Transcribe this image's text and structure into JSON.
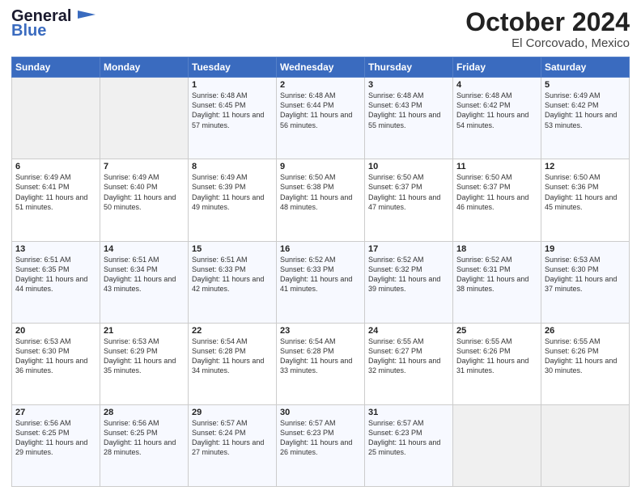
{
  "header": {
    "logo_line1": "General",
    "logo_line2": "Blue",
    "title": "October 2024",
    "subtitle": "El Corcovado, Mexico"
  },
  "calendar": {
    "headers": [
      "Sunday",
      "Monday",
      "Tuesday",
      "Wednesday",
      "Thursday",
      "Friday",
      "Saturday"
    ],
    "weeks": [
      [
        {
          "day": "",
          "detail": ""
        },
        {
          "day": "",
          "detail": ""
        },
        {
          "day": "1",
          "detail": "Sunrise: 6:48 AM\nSunset: 6:45 PM\nDaylight: 11 hours and 57 minutes."
        },
        {
          "day": "2",
          "detail": "Sunrise: 6:48 AM\nSunset: 6:44 PM\nDaylight: 11 hours and 56 minutes."
        },
        {
          "day": "3",
          "detail": "Sunrise: 6:48 AM\nSunset: 6:43 PM\nDaylight: 11 hours and 55 minutes."
        },
        {
          "day": "4",
          "detail": "Sunrise: 6:48 AM\nSunset: 6:42 PM\nDaylight: 11 hours and 54 minutes."
        },
        {
          "day": "5",
          "detail": "Sunrise: 6:49 AM\nSunset: 6:42 PM\nDaylight: 11 hours and 53 minutes."
        }
      ],
      [
        {
          "day": "6",
          "detail": "Sunrise: 6:49 AM\nSunset: 6:41 PM\nDaylight: 11 hours and 51 minutes."
        },
        {
          "day": "7",
          "detail": "Sunrise: 6:49 AM\nSunset: 6:40 PM\nDaylight: 11 hours and 50 minutes."
        },
        {
          "day": "8",
          "detail": "Sunrise: 6:49 AM\nSunset: 6:39 PM\nDaylight: 11 hours and 49 minutes."
        },
        {
          "day": "9",
          "detail": "Sunrise: 6:50 AM\nSunset: 6:38 PM\nDaylight: 11 hours and 48 minutes."
        },
        {
          "day": "10",
          "detail": "Sunrise: 6:50 AM\nSunset: 6:37 PM\nDaylight: 11 hours and 47 minutes."
        },
        {
          "day": "11",
          "detail": "Sunrise: 6:50 AM\nSunset: 6:37 PM\nDaylight: 11 hours and 46 minutes."
        },
        {
          "day": "12",
          "detail": "Sunrise: 6:50 AM\nSunset: 6:36 PM\nDaylight: 11 hours and 45 minutes."
        }
      ],
      [
        {
          "day": "13",
          "detail": "Sunrise: 6:51 AM\nSunset: 6:35 PM\nDaylight: 11 hours and 44 minutes."
        },
        {
          "day": "14",
          "detail": "Sunrise: 6:51 AM\nSunset: 6:34 PM\nDaylight: 11 hours and 43 minutes."
        },
        {
          "day": "15",
          "detail": "Sunrise: 6:51 AM\nSunset: 6:33 PM\nDaylight: 11 hours and 42 minutes."
        },
        {
          "day": "16",
          "detail": "Sunrise: 6:52 AM\nSunset: 6:33 PM\nDaylight: 11 hours and 41 minutes."
        },
        {
          "day": "17",
          "detail": "Sunrise: 6:52 AM\nSunset: 6:32 PM\nDaylight: 11 hours and 39 minutes."
        },
        {
          "day": "18",
          "detail": "Sunrise: 6:52 AM\nSunset: 6:31 PM\nDaylight: 11 hours and 38 minutes."
        },
        {
          "day": "19",
          "detail": "Sunrise: 6:53 AM\nSunset: 6:30 PM\nDaylight: 11 hours and 37 minutes."
        }
      ],
      [
        {
          "day": "20",
          "detail": "Sunrise: 6:53 AM\nSunset: 6:30 PM\nDaylight: 11 hours and 36 minutes."
        },
        {
          "day": "21",
          "detail": "Sunrise: 6:53 AM\nSunset: 6:29 PM\nDaylight: 11 hours and 35 minutes."
        },
        {
          "day": "22",
          "detail": "Sunrise: 6:54 AM\nSunset: 6:28 PM\nDaylight: 11 hours and 34 minutes."
        },
        {
          "day": "23",
          "detail": "Sunrise: 6:54 AM\nSunset: 6:28 PM\nDaylight: 11 hours and 33 minutes."
        },
        {
          "day": "24",
          "detail": "Sunrise: 6:55 AM\nSunset: 6:27 PM\nDaylight: 11 hours and 32 minutes."
        },
        {
          "day": "25",
          "detail": "Sunrise: 6:55 AM\nSunset: 6:26 PM\nDaylight: 11 hours and 31 minutes."
        },
        {
          "day": "26",
          "detail": "Sunrise: 6:55 AM\nSunset: 6:26 PM\nDaylight: 11 hours and 30 minutes."
        }
      ],
      [
        {
          "day": "27",
          "detail": "Sunrise: 6:56 AM\nSunset: 6:25 PM\nDaylight: 11 hours and 29 minutes."
        },
        {
          "day": "28",
          "detail": "Sunrise: 6:56 AM\nSunset: 6:25 PM\nDaylight: 11 hours and 28 minutes."
        },
        {
          "day": "29",
          "detail": "Sunrise: 6:57 AM\nSunset: 6:24 PM\nDaylight: 11 hours and 27 minutes."
        },
        {
          "day": "30",
          "detail": "Sunrise: 6:57 AM\nSunset: 6:23 PM\nDaylight: 11 hours and 26 minutes."
        },
        {
          "day": "31",
          "detail": "Sunrise: 6:57 AM\nSunset: 6:23 PM\nDaylight: 11 hours and 25 minutes."
        },
        {
          "day": "",
          "detail": ""
        },
        {
          "day": "",
          "detail": ""
        }
      ]
    ]
  }
}
